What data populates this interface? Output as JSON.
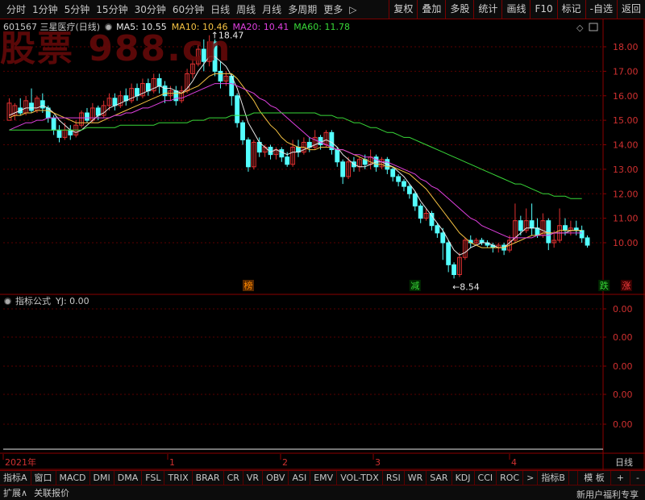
{
  "toolbar": {
    "periods": [
      "分时",
      "1分钟",
      "5分钟",
      "15分钟",
      "30分钟",
      "60分钟",
      "日线",
      "周线",
      "月线",
      "多周期",
      "更多"
    ],
    "more_arrow": "▷",
    "actions": [
      "复权",
      "叠加",
      "多股",
      "统计",
      "画线",
      "F10",
      "标记",
      "-自选",
      "返回"
    ]
  },
  "watermark": "股票 988.cn",
  "info": {
    "stock": "601567 三星医疗(日线)",
    "dot": "●",
    "ma5": "MA5: 10.55",
    "ma10": "MA10: 10.46",
    "ma20": "MA20: 10.41",
    "ma60": "MA60: 11.78"
  },
  "indicator": {
    "name": "指标公式",
    "value": "YJ: 0.00",
    "axis_labels": [
      "0.00",
      "0.00",
      "0.00",
      "0.00",
      "0.00"
    ]
  },
  "annotations": {
    "high": "18.47",
    "low": "8.54",
    "tags": [
      "榜",
      "减",
      "跌",
      "涨"
    ]
  },
  "time_axis": {
    "labels": [
      "2021年",
      "1",
      "2",
      "3",
      "4"
    ],
    "period_label": "日线"
  },
  "tabs": [
    "指标A",
    "窗口",
    "MACD",
    "DMI",
    "DMA",
    "FSL",
    "TRIX",
    "BRAR",
    "CR",
    "VR",
    "OBV",
    "ASI",
    "EMV",
    "VOL-TDX",
    "RSI",
    "WR",
    "SAR",
    "KDJ",
    "CCI",
    "ROC",
    ">",
    "指标B"
  ],
  "tabs_right": [
    "模 板",
    "+",
    "-"
  ],
  "status": {
    "expand": "扩展∧",
    "related": "关联报价",
    "promo": "新用户福利专享"
  },
  "chart_data": {
    "type": "candlestick",
    "y_axis_labels": [
      18.0,
      17.0,
      16.0,
      15.0,
      14.0,
      13.0,
      12.0,
      11.0,
      10.0
    ],
    "ylim": [
      8.2,
      18.6
    ],
    "high_mark": 18.47,
    "low_mark": 8.54,
    "ma_values": {
      "MA5": 10.55,
      "MA10": 10.46,
      "MA20": 10.41,
      "MA60": 11.78
    },
    "candles": [
      [
        15.0,
        15.7,
        15.1,
        15.9
      ],
      [
        15.2,
        15.6,
        15.0,
        15.7
      ],
      [
        15.5,
        15.3,
        15.2,
        15.9
      ],
      [
        15.3,
        15.8,
        15.2,
        16.0
      ],
      [
        15.7,
        15.4,
        15.3,
        16.3
      ],
      [
        15.4,
        15.9,
        15.3,
        16.0
      ],
      [
        15.8,
        15.5,
        15.3,
        16.1
      ],
      [
        15.5,
        15.1,
        14.9,
        15.6
      ],
      [
        15.1,
        14.6,
        14.4,
        15.2
      ],
      [
        14.6,
        14.3,
        14.1,
        14.8
      ],
      [
        14.3,
        14.6,
        14.2,
        14.9
      ],
      [
        14.6,
        14.4,
        14.2,
        14.8
      ],
      [
        14.4,
        14.8,
        14.3,
        15.0
      ],
      [
        14.8,
        15.3,
        14.7,
        15.4
      ],
      [
        15.3,
        15.0,
        14.9,
        15.5
      ],
      [
        15.0,
        15.5,
        14.9,
        15.7
      ],
      [
        15.5,
        15.2,
        15.0,
        15.6
      ],
      [
        15.2,
        15.6,
        15.1,
        15.8
      ],
      [
        15.6,
        15.9,
        15.4,
        16.1
      ],
      [
        15.9,
        15.6,
        15.4,
        16.1
      ],
      [
        15.6,
        16.0,
        15.5,
        16.2
      ],
      [
        16.0,
        15.8,
        15.6,
        16.3
      ],
      [
        15.8,
        16.3,
        15.7,
        16.5
      ],
      [
        16.3,
        16.0,
        15.8,
        16.5
      ],
      [
        16.0,
        16.5,
        15.9,
        16.7
      ],
      [
        16.5,
        16.2,
        16.0,
        16.7
      ],
      [
        16.2,
        16.7,
        16.1,
        16.9
      ],
      [
        16.7,
        16.4,
        16.1,
        16.9
      ],
      [
        16.4,
        16.0,
        15.7,
        16.6
      ],
      [
        16.0,
        16.2,
        15.8,
        16.4
      ],
      [
        16.2,
        15.8,
        15.6,
        16.4
      ],
      [
        15.8,
        16.2,
        15.7,
        16.4
      ],
      [
        16.2,
        16.9,
        16.1,
        17.1
      ],
      [
        16.9,
        17.3,
        16.7,
        17.5
      ],
      [
        17.3,
        17.9,
        17.2,
        18.1
      ],
      [
        17.9,
        17.4,
        17.0,
        18.3
      ],
      [
        17.4,
        18.2,
        17.2,
        18.47
      ],
      [
        18.2,
        17.0,
        16.8,
        18.3
      ],
      [
        17.0,
        16.6,
        16.3,
        17.4
      ],
      [
        16.6,
        16.8,
        16.4,
        17.0
      ],
      [
        16.8,
        16.0,
        15.6,
        16.9
      ],
      [
        16.0,
        14.9,
        14.7,
        16.1
      ],
      [
        14.9,
        14.2,
        14.0,
        15.0
      ],
      [
        14.2,
        13.1,
        12.9,
        14.3
      ],
      [
        13.1,
        14.1,
        13.0,
        14.2
      ],
      [
        14.1,
        13.7,
        13.5,
        14.3
      ],
      [
        13.7,
        13.9,
        13.5,
        14.0
      ],
      [
        13.9,
        13.6,
        13.4,
        14.0
      ],
      [
        13.6,
        13.8,
        13.4,
        13.9
      ],
      [
        13.8,
        13.5,
        13.3,
        13.9
      ],
      [
        13.5,
        13.2,
        13.1,
        13.7
      ],
      [
        13.2,
        13.9,
        13.1,
        14.2
      ],
      [
        13.9,
        13.7,
        13.5,
        14.2
      ],
      [
        13.7,
        14.1,
        13.6,
        14.3
      ],
      [
        14.1,
        13.9,
        13.7,
        14.3
      ],
      [
        13.9,
        14.3,
        13.8,
        14.6
      ],
      [
        14.3,
        14.0,
        13.8,
        14.4
      ],
      [
        14.0,
        14.5,
        13.9,
        14.6
      ],
      [
        14.5,
        13.8,
        13.6,
        14.6
      ],
      [
        13.8,
        13.3,
        13.1,
        13.9
      ],
      [
        13.3,
        12.7,
        12.4,
        13.4
      ],
      [
        12.7,
        13.3,
        12.6,
        13.5
      ],
      [
        13.3,
        13.1,
        12.9,
        13.5
      ],
      [
        13.1,
        13.4,
        12.9,
        13.5
      ],
      [
        13.4,
        13.2,
        13.0,
        13.6
      ],
      [
        13.2,
        13.5,
        13.0,
        13.8
      ],
      [
        13.5,
        13.1,
        12.9,
        13.6
      ],
      [
        13.1,
        13.4,
        13.0,
        13.5
      ],
      [
        13.4,
        13.0,
        12.8,
        13.5
      ],
      [
        13.0,
        12.7,
        12.5,
        13.1
      ],
      [
        12.7,
        12.5,
        12.3,
        12.8
      ],
      [
        12.5,
        12.3,
        12.1,
        12.6
      ],
      [
        12.3,
        12.0,
        11.8,
        12.4
      ],
      [
        12.0,
        11.5,
        11.3,
        12.1
      ],
      [
        11.5,
        11.0,
        10.8,
        11.6
      ],
      [
        11.0,
        11.2,
        10.9,
        11.4
      ],
      [
        11.2,
        10.7,
        10.5,
        11.3
      ],
      [
        10.7,
        10.4,
        10.2,
        10.8
      ],
      [
        10.4,
        10.0,
        9.3,
        10.6
      ],
      [
        10.0,
        9.1,
        8.8,
        10.1
      ],
      [
        9.1,
        8.7,
        8.54,
        9.2
      ],
      [
        8.7,
        9.4,
        8.6,
        9.6
      ],
      [
        9.4,
        10.1,
        9.3,
        10.2
      ],
      [
        10.1,
        10.0,
        9.8,
        10.3
      ],
      [
        10.0,
        10.1,
        9.9,
        10.2
      ],
      [
        10.1,
        10.0,
        9.9,
        10.2
      ],
      [
        10.0,
        9.9,
        9.8,
        10.1
      ],
      [
        9.9,
        9.8,
        9.6,
        10.0
      ],
      [
        9.8,
        9.9,
        9.6,
        10.0
      ],
      [
        9.9,
        9.7,
        9.5,
        10.0
      ],
      [
        9.7,
        10.1,
        9.6,
        10.3
      ],
      [
        10.1,
        10.9,
        10.0,
        11.6
      ],
      [
        10.9,
        10.5,
        10.3,
        11.1
      ],
      [
        10.5,
        10.9,
        10.4,
        11.4
      ],
      [
        10.9,
        10.6,
        10.3,
        11.6
      ],
      [
        10.6,
        10.3,
        10.2,
        11.0
      ],
      [
        10.3,
        10.9,
        10.2,
        11.2
      ],
      [
        10.9,
        10.0,
        9.7,
        11.0
      ],
      [
        10.0,
        10.1,
        9.8,
        10.5
      ],
      [
        10.1,
        10.7,
        10.0,
        11.4
      ],
      [
        10.7,
        10.5,
        10.3,
        11.0
      ],
      [
        10.5,
        10.6,
        10.3,
        10.9
      ],
      [
        10.6,
        10.5,
        10.3,
        10.9
      ],
      [
        10.5,
        10.2,
        10.0,
        10.7
      ],
      [
        10.2,
        9.9,
        9.8,
        10.3
      ]
    ],
    "series": [
      {
        "name": "MA5",
        "color": "#e8e8e8",
        "values": [
          15.2,
          15.3,
          15.4,
          15.5,
          15.5,
          15.5,
          15.6,
          15.5,
          15.3,
          15.0,
          14.8,
          14.6,
          14.5,
          14.6,
          14.8,
          15.0,
          15.2,
          15.3,
          15.5,
          15.6,
          15.7,
          15.8,
          15.9,
          16.0,
          16.1,
          16.2,
          16.3,
          16.4,
          16.3,
          16.3,
          16.2,
          16.1,
          16.3,
          16.6,
          17.0,
          17.3,
          17.6,
          17.6,
          17.4,
          17.2,
          16.8,
          16.3,
          15.6,
          14.9,
          14.5,
          14.1,
          13.9,
          13.7,
          13.8,
          13.7,
          13.6,
          13.7,
          13.7,
          13.8,
          13.9,
          14.0,
          14.1,
          14.2,
          14.1,
          13.9,
          13.6,
          13.4,
          13.2,
          13.1,
          13.1,
          13.2,
          13.3,
          13.3,
          13.2,
          13.1,
          12.9,
          12.7,
          12.4,
          12.1,
          11.7,
          11.4,
          11.1,
          10.8,
          10.5,
          10.1,
          9.7,
          9.5,
          9.6,
          9.8,
          9.9,
          10.0,
          10.0,
          9.9,
          9.8,
          9.8,
          10.0,
          10.2,
          10.4,
          10.6,
          10.6,
          10.6,
          10.5,
          10.4,
          10.4,
          10.4,
          10.4,
          10.5,
          10.5,
          10.5
        ]
      },
      {
        "name": "MA10",
        "color": "#f5c242",
        "values": [
          15.1,
          15.2,
          15.2,
          15.3,
          15.3,
          15.4,
          15.4,
          15.4,
          15.3,
          15.2,
          15.1,
          15.0,
          14.9,
          14.9,
          14.9,
          14.9,
          14.9,
          15.0,
          15.1,
          15.2,
          15.3,
          15.4,
          15.5,
          15.6,
          15.7,
          15.8,
          15.9,
          16.0,
          16.1,
          16.1,
          16.1,
          16.1,
          16.2,
          16.3,
          16.4,
          16.6,
          16.8,
          16.9,
          16.9,
          16.9,
          16.9,
          16.7,
          16.4,
          16.1,
          15.8,
          15.4,
          15.1,
          14.8,
          14.6,
          14.3,
          14.1,
          14.0,
          13.9,
          13.9,
          13.8,
          13.8,
          13.9,
          13.9,
          13.9,
          13.8,
          13.8,
          13.7,
          13.6,
          13.5,
          13.4,
          13.3,
          13.2,
          13.2,
          13.1,
          13.1,
          13.0,
          12.9,
          12.8,
          12.6,
          12.4,
          12.2,
          11.9,
          11.6,
          11.3,
          11.0,
          10.7,
          10.4,
          10.2,
          10.0,
          9.9,
          9.8,
          9.8,
          9.8,
          9.8,
          9.8,
          9.9,
          10.0,
          10.1,
          10.2,
          10.3,
          10.3,
          10.4,
          10.4,
          10.4,
          10.5,
          10.5,
          10.5,
          10.5,
          10.5
        ]
      },
      {
        "name": "MA20",
        "color": "#e040e0",
        "values": [
          14.6,
          14.7,
          14.8,
          14.9,
          14.9,
          15.0,
          15.0,
          15.1,
          15.1,
          15.1,
          15.1,
          15.1,
          15.1,
          15.1,
          15.1,
          15.1,
          15.1,
          15.1,
          15.1,
          15.2,
          15.2,
          15.3,
          15.3,
          15.4,
          15.5,
          15.5,
          15.6,
          15.7,
          15.8,
          15.8,
          15.9,
          15.9,
          16.0,
          16.1,
          16.2,
          16.3,
          16.4,
          16.5,
          16.5,
          16.5,
          16.5,
          16.4,
          16.3,
          16.2,
          16.1,
          15.9,
          15.8,
          15.6,
          15.5,
          15.3,
          15.1,
          14.9,
          14.7,
          14.5,
          14.3,
          14.2,
          14.1,
          14.0,
          13.9,
          13.8,
          13.8,
          13.7,
          13.6,
          13.6,
          13.5,
          13.5,
          13.4,
          13.3,
          13.3,
          13.2,
          13.1,
          13.0,
          12.9,
          12.8,
          12.6,
          12.5,
          12.3,
          12.2,
          12.0,
          11.8,
          11.6,
          11.4,
          11.2,
          11.0,
          10.9,
          10.7,
          10.6,
          10.5,
          10.4,
          10.3,
          10.2,
          10.2,
          10.2,
          10.2,
          10.2,
          10.3,
          10.3,
          10.3,
          10.4,
          10.4,
          10.4,
          10.4,
          10.4,
          10.4
        ]
      },
      {
        "name": "MA60",
        "color": "#38d838",
        "values": [
          14.6,
          14.6,
          14.6,
          14.6,
          14.6,
          14.6,
          14.6,
          14.6,
          14.6,
          14.6,
          14.6,
          14.6,
          14.6,
          14.6,
          14.7,
          14.7,
          14.7,
          14.7,
          14.7,
          14.7,
          14.8,
          14.8,
          14.8,
          14.8,
          14.8,
          14.8,
          14.8,
          14.9,
          14.9,
          14.9,
          14.9,
          14.9,
          14.9,
          15.0,
          15.0,
          15.0,
          15.1,
          15.1,
          15.1,
          15.1,
          15.2,
          15.2,
          15.2,
          15.2,
          15.3,
          15.3,
          15.3,
          15.3,
          15.3,
          15.3,
          15.3,
          15.3,
          15.3,
          15.3,
          15.3,
          15.3,
          15.2,
          15.2,
          15.2,
          15.1,
          15.1,
          15.0,
          14.9,
          14.9,
          14.8,
          14.7,
          14.7,
          14.6,
          14.5,
          14.5,
          14.4,
          14.3,
          14.3,
          14.2,
          14.1,
          14.0,
          13.9,
          13.8,
          13.7,
          13.6,
          13.5,
          13.4,
          13.3,
          13.2,
          13.1,
          13.0,
          12.9,
          12.8,
          12.7,
          12.6,
          12.5,
          12.4,
          12.4,
          12.3,
          12.2,
          12.1,
          12.0,
          12.0,
          11.9,
          11.9,
          11.9,
          11.8,
          11.8,
          11.8
        ]
      }
    ],
    "tags": [
      {
        "text": "榜",
        "index": 43,
        "color": "#ff8800",
        "bg": "#5a2a00"
      },
      {
        "text": "减",
        "index": 73,
        "color": "#38d838",
        "bg": "#002a00"
      },
      {
        "text": "跌",
        "index": 107,
        "color": "#38d838",
        "bg": "#002a00"
      },
      {
        "text": "涨",
        "index": 111,
        "color": "#ff4040",
        "bg": "#3a0000"
      }
    ],
    "up_color": "#e03030",
    "down_color": "#54ffff"
  }
}
